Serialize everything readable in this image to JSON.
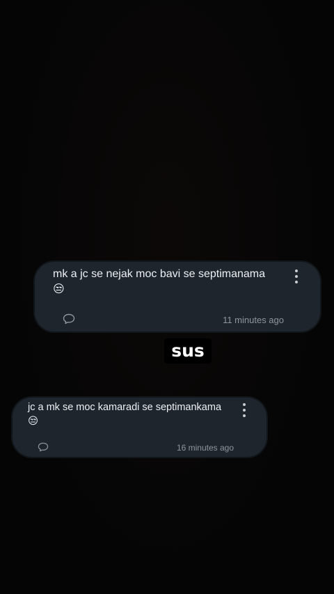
{
  "comments": [
    {
      "text": "mk a jc se nejak moc bavi se septimanama",
      "emoji": "😒",
      "time": "11 minutes ago",
      "icons": {
        "more": "more-vertical-icon",
        "reply": "comment-bubble-icon"
      }
    },
    {
      "text": "jc a mk se moc kamaradi se septimankama",
      "emoji": "😒",
      "time": "16 minutes ago",
      "icons": {
        "more": "more-vertical-icon",
        "reply": "comment-bubble-icon"
      }
    }
  ],
  "overlay": {
    "caption": "sus"
  },
  "colors": {
    "background": "#050505",
    "card": "#1e252d",
    "text": "#eef1f4",
    "muted": "#8f969d"
  }
}
